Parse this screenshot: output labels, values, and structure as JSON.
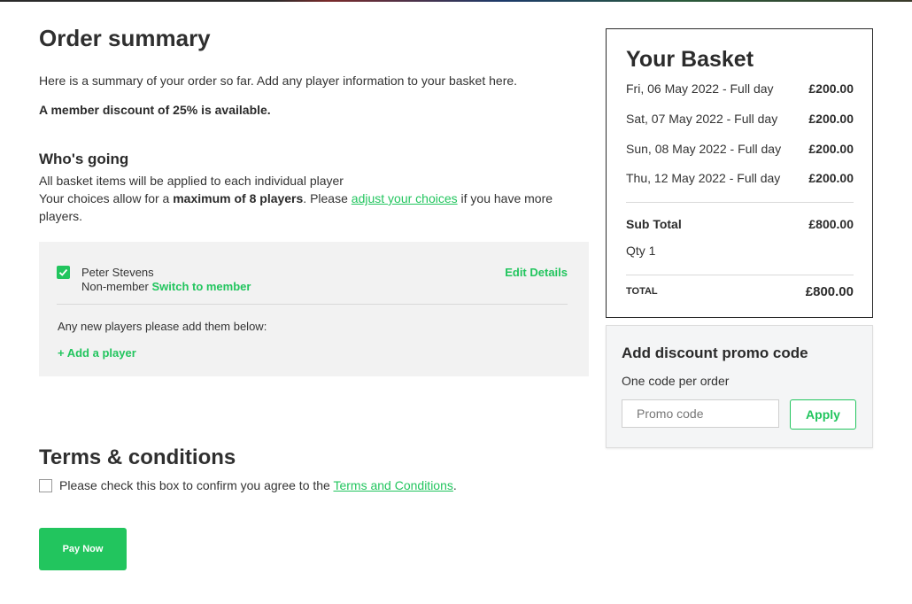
{
  "order": {
    "title": "Order summary",
    "intro": "Here is a summary of your order so far. Add any player information to your basket here.",
    "discount_note": "A member discount of 25% is available."
  },
  "whos_going": {
    "title": "Who's going",
    "line1": "All basket items will be applied to each individual player",
    "line2_prefix": "Your choices allow for a ",
    "line2_bold": "maximum of 8 players",
    "line2_mid": ". Please ",
    "line2_link": "adjust your choices",
    "line2_suffix": " if you have more",
    "line3": "players."
  },
  "players": {
    "list": [
      {
        "name": "Peter Stevens",
        "status": "Non-member",
        "switch_label": "Switch to member",
        "edit_label": "Edit Details",
        "checked": true
      }
    ],
    "new_players_note": "Any new players please add them below:",
    "add_player_label": "+ Add a player"
  },
  "terms": {
    "title": "Terms & conditions",
    "text_prefix": "Please check this box to confirm you agree to the ",
    "link": "Terms and Conditions",
    "text_suffix": "."
  },
  "pay_button": "Pay Now",
  "basket": {
    "title": "Your Basket",
    "items": [
      {
        "label": "Fri, 06 May 2022 - Full day",
        "price": "£200.00"
      },
      {
        "label": "Sat, 07 May 2022 - Full day",
        "price": "£200.00"
      },
      {
        "label": "Sun, 08 May 2022 - Full day",
        "price": "£200.00"
      },
      {
        "label": "Thu, 12 May 2022 - Full day",
        "price": "£200.00"
      }
    ],
    "subtotal_label": "Sub Total",
    "subtotal_value": "£800.00",
    "qty_label": "Qty 1",
    "total_label": "TOTAL",
    "total_value": "£800.00"
  },
  "promo": {
    "title": "Add discount promo code",
    "subtitle": "One code per order",
    "placeholder": "Promo code",
    "apply_label": "Apply"
  },
  "colors": {
    "accent": "#22c55e",
    "panel": "#f2f2f2",
    "text": "#2b2b2b"
  }
}
